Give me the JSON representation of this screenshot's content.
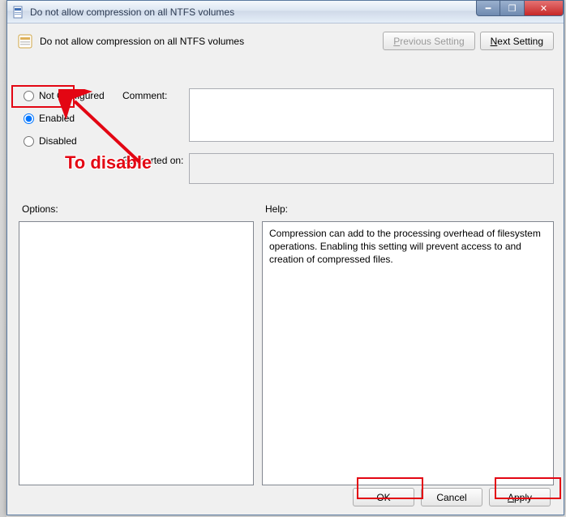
{
  "window": {
    "title": "Do not allow compression on all NTFS volumes"
  },
  "header": {
    "policy_title": "Do not allow compression on all NTFS volumes",
    "prev_label": "Previous Setting",
    "next_label": "Next Setting"
  },
  "radios": {
    "not_configured": "Not Configured",
    "enabled": "Enabled",
    "disabled": "Disabled",
    "selected": "enabled"
  },
  "labels": {
    "comment": "Comment:",
    "supported": "Supported on:",
    "options": "Options:",
    "help": "Help:"
  },
  "fields": {
    "comment_value": "",
    "supported_value": ""
  },
  "help_text": "Compression can add to the processing overhead of filesystem operations.  Enabling this setting will prevent access to and creation of compressed files.",
  "buttons": {
    "ok": "OK",
    "cancel": "Cancel",
    "apply": "Apply"
  },
  "annotations": {
    "to_disable": "To disable"
  },
  "window_controls": {
    "minimize_glyph": "━",
    "maximize_glyph": "❐",
    "close_glyph": "✕"
  }
}
